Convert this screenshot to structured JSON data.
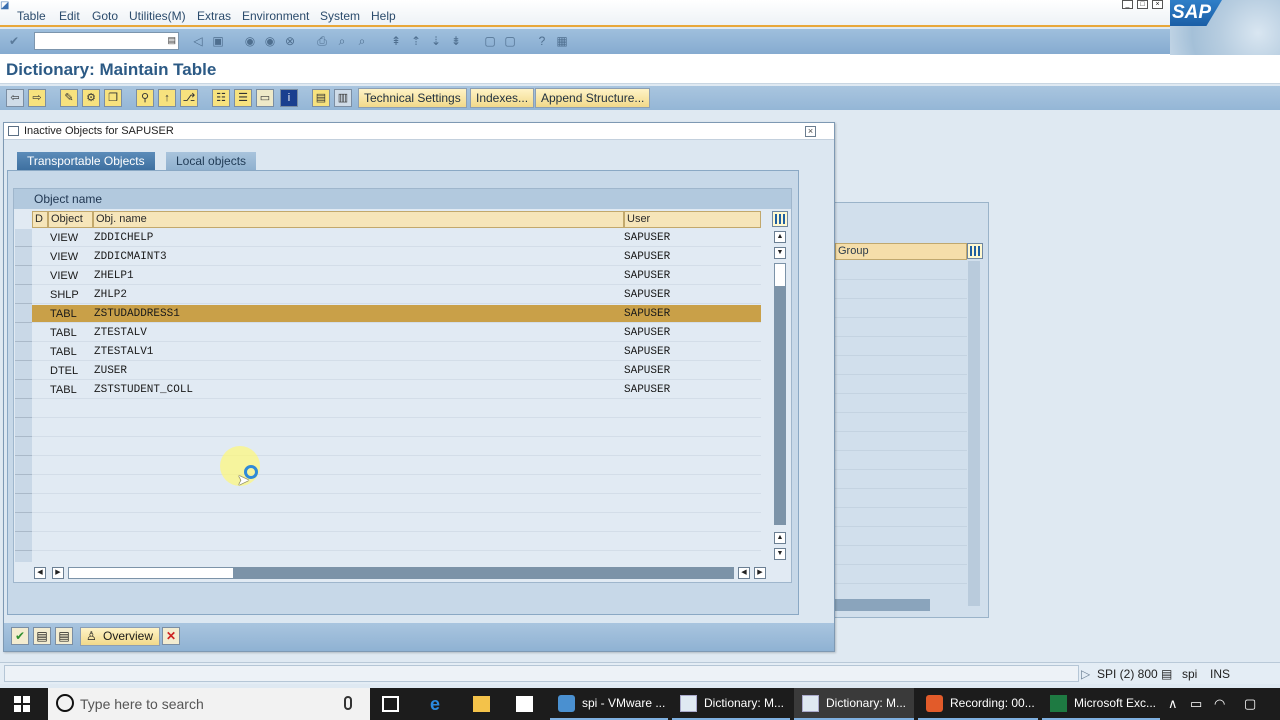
{
  "menu": [
    "Table",
    "Edit",
    "Goto",
    "Utilities(M)",
    "Extras",
    "Environment",
    "System",
    "Help"
  ],
  "logo_text": "SAP",
  "page_title": "Dictionary: Maintain Table",
  "app_toolbar": {
    "technical_settings": "Technical Settings",
    "indexes": "Indexes...",
    "append_structure": "Append Structure..."
  },
  "background_grid": {
    "group_header": "Group"
  },
  "dialog": {
    "title": "Inactive Objects for SAPUSER",
    "tabs": [
      "Transportable Objects",
      "Local objects"
    ],
    "grid_title": "Object name",
    "columns": [
      "D",
      "Object",
      "Obj. name",
      "User"
    ],
    "rows": [
      {
        "d": "",
        "object": "VIEW",
        "name": "ZDDICHELP",
        "user": "SAPUSER",
        "selected": false
      },
      {
        "d": "",
        "object": "VIEW",
        "name": "ZDDICMAINT3",
        "user": "SAPUSER",
        "selected": false
      },
      {
        "d": "",
        "object": "VIEW",
        "name": "ZHELP1",
        "user": "SAPUSER",
        "selected": false
      },
      {
        "d": "",
        "object": "SHLP",
        "name": "ZHLP2",
        "user": "SAPUSER",
        "selected": false
      },
      {
        "d": "",
        "object": "TABL",
        "name": "ZSTUDADDRESS1",
        "user": "SAPUSER",
        "selected": true
      },
      {
        "d": "",
        "object": "TABL",
        "name": "ZTESTALV",
        "user": "SAPUSER",
        "selected": false
      },
      {
        "d": "",
        "object": "TABL",
        "name": "ZTESTALV1",
        "user": "SAPUSER",
        "selected": false
      },
      {
        "d": "",
        "object": "DTEL",
        "name": "ZUSER",
        "user": "SAPUSER",
        "selected": false
      },
      {
        "d": "",
        "object": "TABL",
        "name": "ZSTSTUDENT_COLL",
        "user": "SAPUSER",
        "selected": false
      }
    ],
    "footer": {
      "overview_label": "Overview"
    }
  },
  "status_bar": {
    "system": "SPI (2) 800",
    "server": "spi",
    "mode": "INS"
  },
  "taskbar": {
    "search_placeholder": "Type here to search",
    "tasks": [
      "spi - VMware ...",
      "Dictionary: M...",
      "Dictionary: M...",
      "Recording: 00...",
      "Microsoft Exc..."
    ]
  },
  "colors": {
    "selected_row": "#c9a048",
    "active_tab": "#3e70a0",
    "menu_underline": "#e8a73a"
  }
}
